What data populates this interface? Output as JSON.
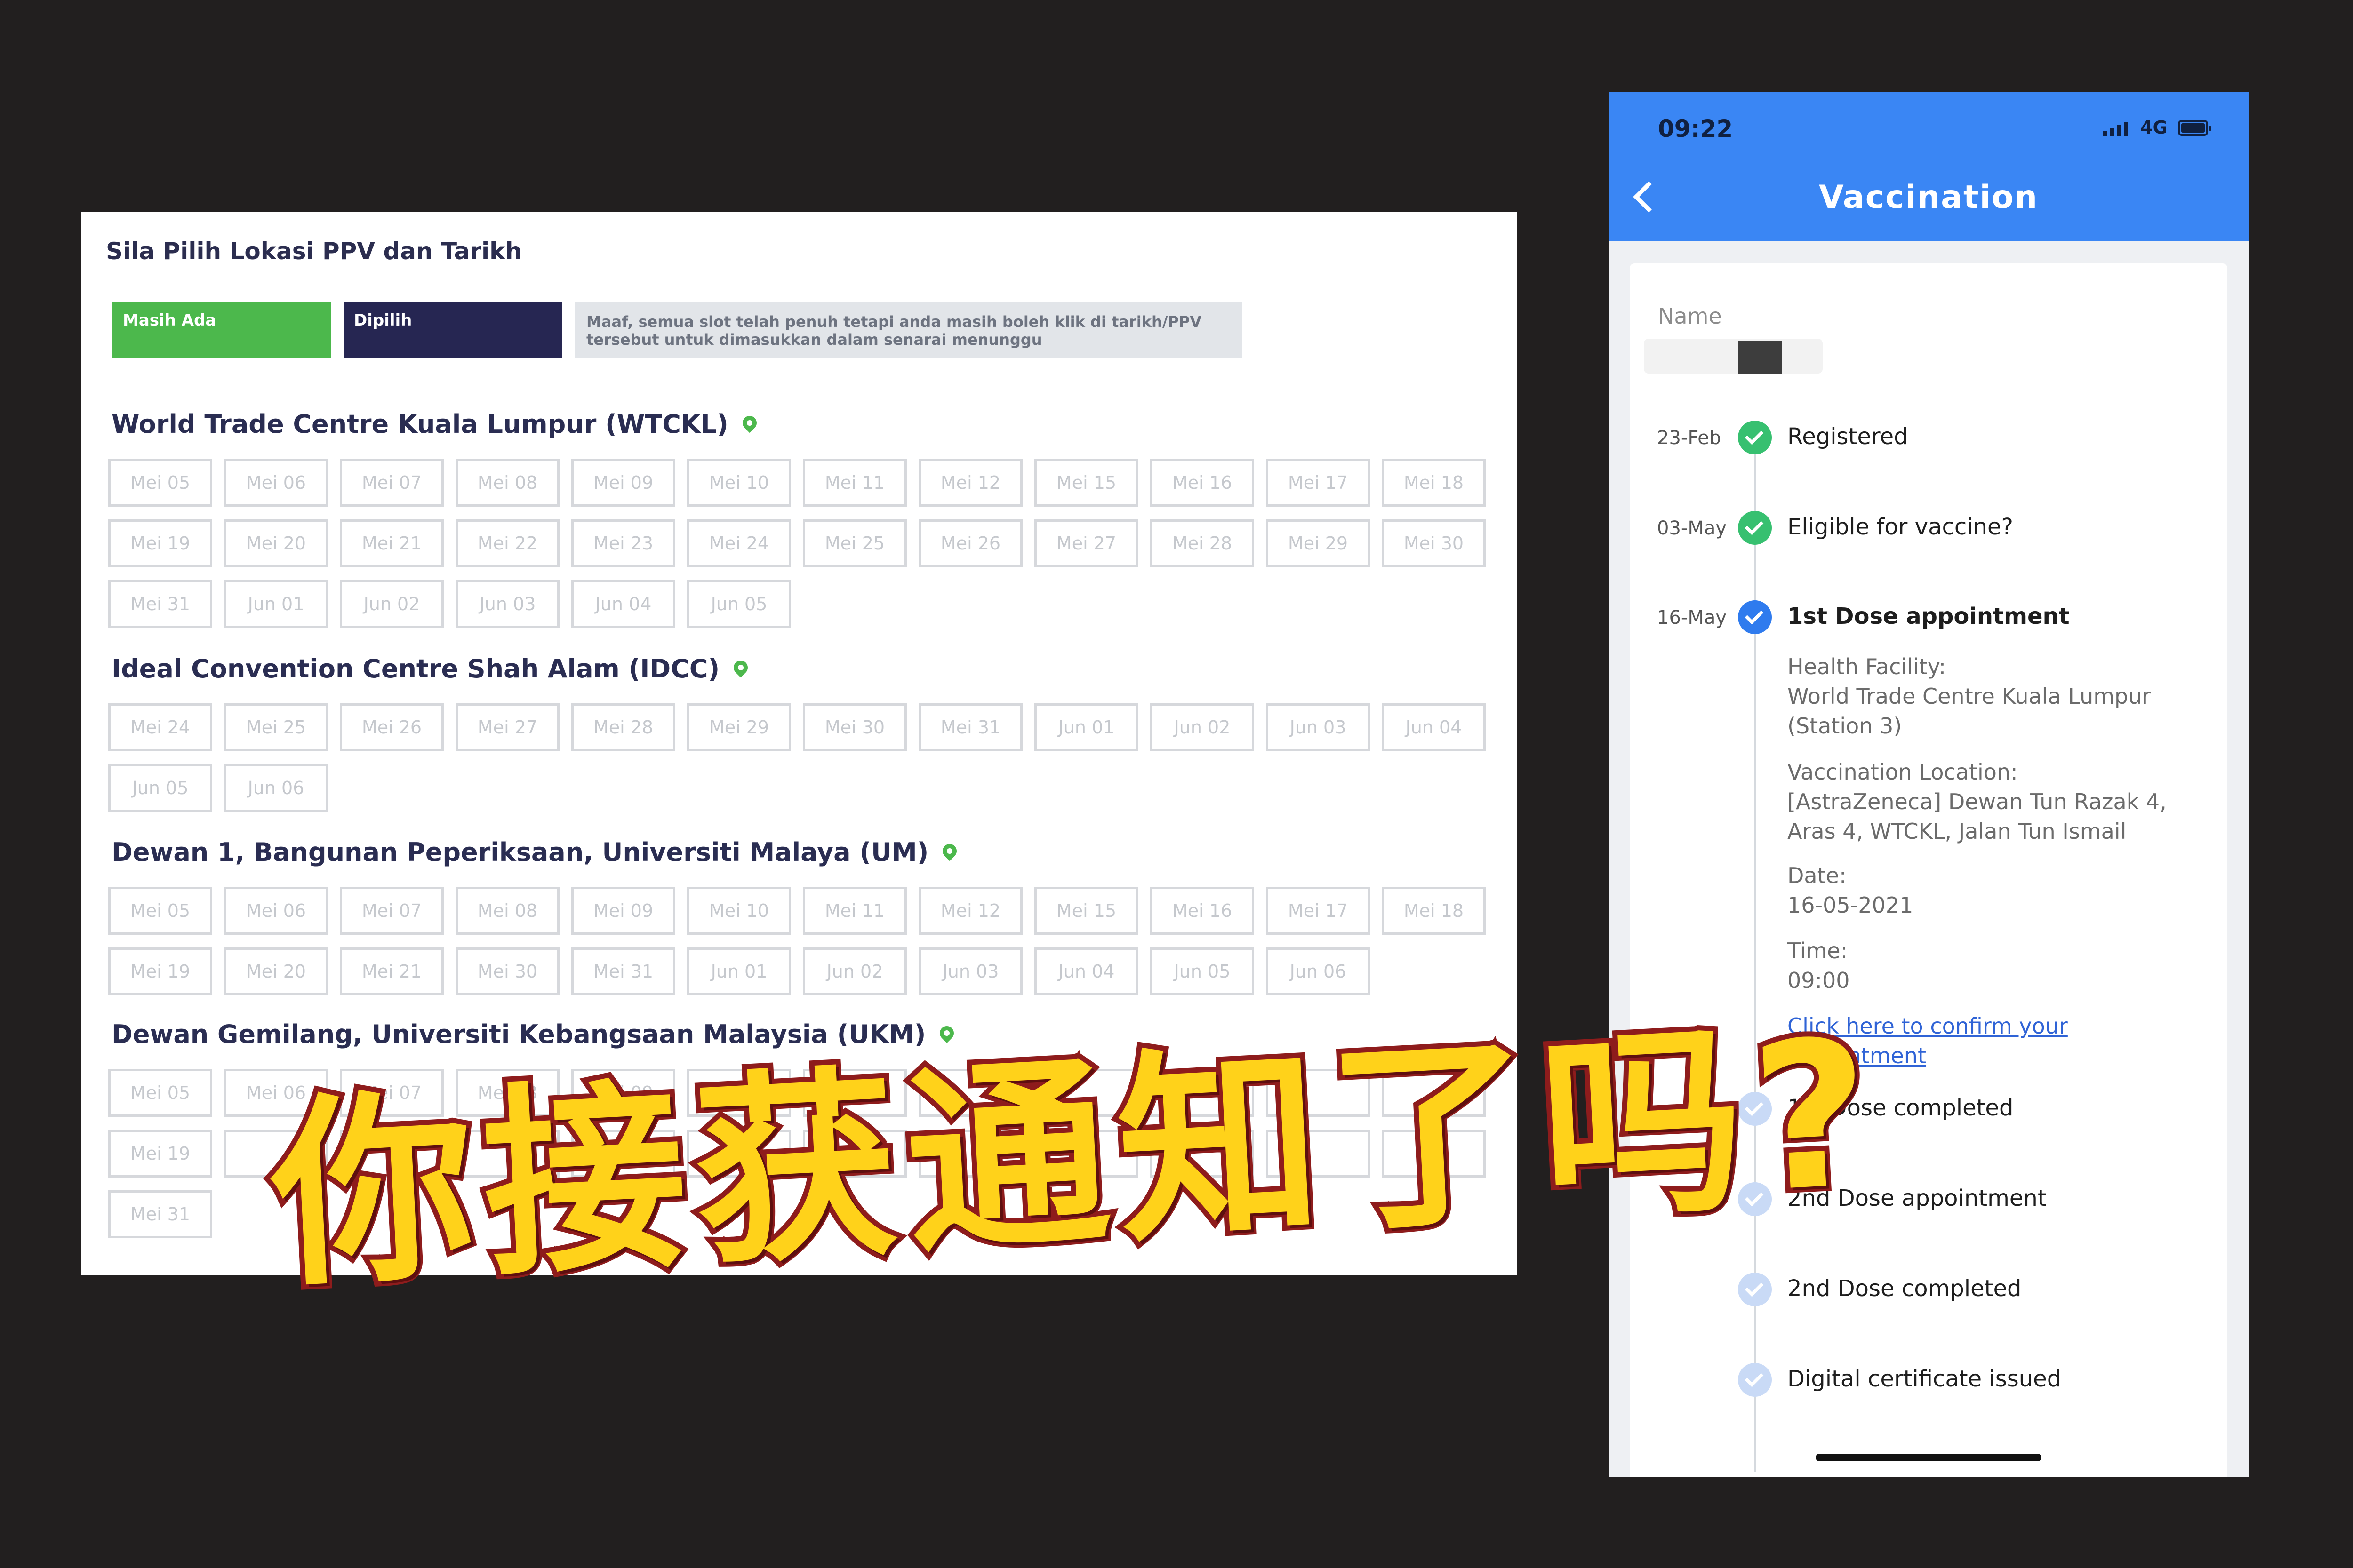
{
  "booking": {
    "title": "Sila Pilih Lokasi PPV dan Tarikh",
    "legend": {
      "available": "Masih Ada",
      "selected": "Dipilih",
      "full_note": "Maaf, semua slot telah penuh tetapi anda masih boleh klik di tarikh/PPV tersebut untuk dimasukkan dalam senarai menunggu"
    },
    "locations": [
      {
        "name": "World Trade Centre Kuala Lumpur (WTCKL)",
        "dates": [
          "Mei 05",
          "Mei 06",
          "Mei 07",
          "Mei 08",
          "Mei 09",
          "Mei 10",
          "Mei 11",
          "Mei 12",
          "Mei 15",
          "Mei 16",
          "Mei 17",
          "Mei 18",
          "Mei 19",
          "Mei 20",
          "Mei 21",
          "Mei 22",
          "Mei 23",
          "Mei 24",
          "Mei 25",
          "Mei 26",
          "Mei 27",
          "Mei 28",
          "Mei 29",
          "Mei 30",
          "Mei 31",
          "Jun 01",
          "Jun 02",
          "Jun 03",
          "Jun 04",
          "Jun 05"
        ]
      },
      {
        "name": "Ideal Convention Centre Shah Alam (IDCC)",
        "dates": [
          "Mei 24",
          "Mei 25",
          "Mei 26",
          "Mei 27",
          "Mei 28",
          "Mei 29",
          "Mei 30",
          "Mei 31",
          "Jun 01",
          "Jun 02",
          "Jun 03",
          "Jun 04",
          "Jun 05",
          "Jun 06"
        ]
      },
      {
        "name": "Dewan 1, Bangunan Peperiksaan, Universiti Malaya (UM)",
        "dates": [
          "Mei 05",
          "Mei 06",
          "Mei 07",
          "Mei 08",
          "Mei 09",
          "Mei 10",
          "Mei 11",
          "Mei 12",
          "Mei 15",
          "Mei 16",
          "Mei 17",
          "Mei 18",
          "Mei 19",
          "Mei 20",
          "Mei 21",
          "Mei 30",
          "Mei 31",
          "Jun 01",
          "Jun 02",
          "Jun 03",
          "Jun 04",
          "Jun 05",
          "Jun 06"
        ]
      },
      {
        "name": "Dewan Gemilang, Universiti Kebangsaan Malaysia (UKM)",
        "dates": [
          "Mei 05",
          "Mei 06",
          "Mei 07",
          "Mei 08",
          "Mei 09",
          "",
          "",
          "",
          "",
          "",
          "",
          "",
          "Mei 19",
          "",
          "",
          "",
          "",
          "",
          "",
          "",
          "",
          "",
          "",
          "Mei",
          "Mei 31"
        ]
      }
    ]
  },
  "phone": {
    "status_time": "09:22",
    "network": "4G",
    "header_title": "Vaccination",
    "name_label": "Name",
    "timeline": [
      {
        "date": "23-Feb",
        "label": "Registered",
        "state": "done"
      },
      {
        "date": "03-May",
        "label": "Eligible for vaccine?",
        "state": "done"
      },
      {
        "date": "16-May",
        "label": "1st Dose appointment",
        "state": "active"
      },
      {
        "date": "",
        "label": "1st Dose completed",
        "state": "pending"
      },
      {
        "date": "",
        "label": "2nd Dose appointment",
        "state": "pending"
      },
      {
        "date": "",
        "label": "2nd Dose completed",
        "state": "pending"
      },
      {
        "date": "",
        "label": "Digital certificate issued",
        "state": "pending"
      }
    ],
    "appointment": {
      "facility_label": "Health Facility:",
      "facility": "World Trade Centre Kuala Lumpur (Station 3)",
      "location_label": "Vaccination Location:",
      "location": "[AstraZeneca] Dewan Tun Razak 4, Aras 4, WTCKL, Jalan Tun Ismail",
      "date_label": "Date:",
      "date": "16-05-2021",
      "time_label": "Time:",
      "time": "09:00",
      "confirm_link": "Click here to confirm your appointment"
    }
  },
  "caption": "你接获通知了吗?"
}
